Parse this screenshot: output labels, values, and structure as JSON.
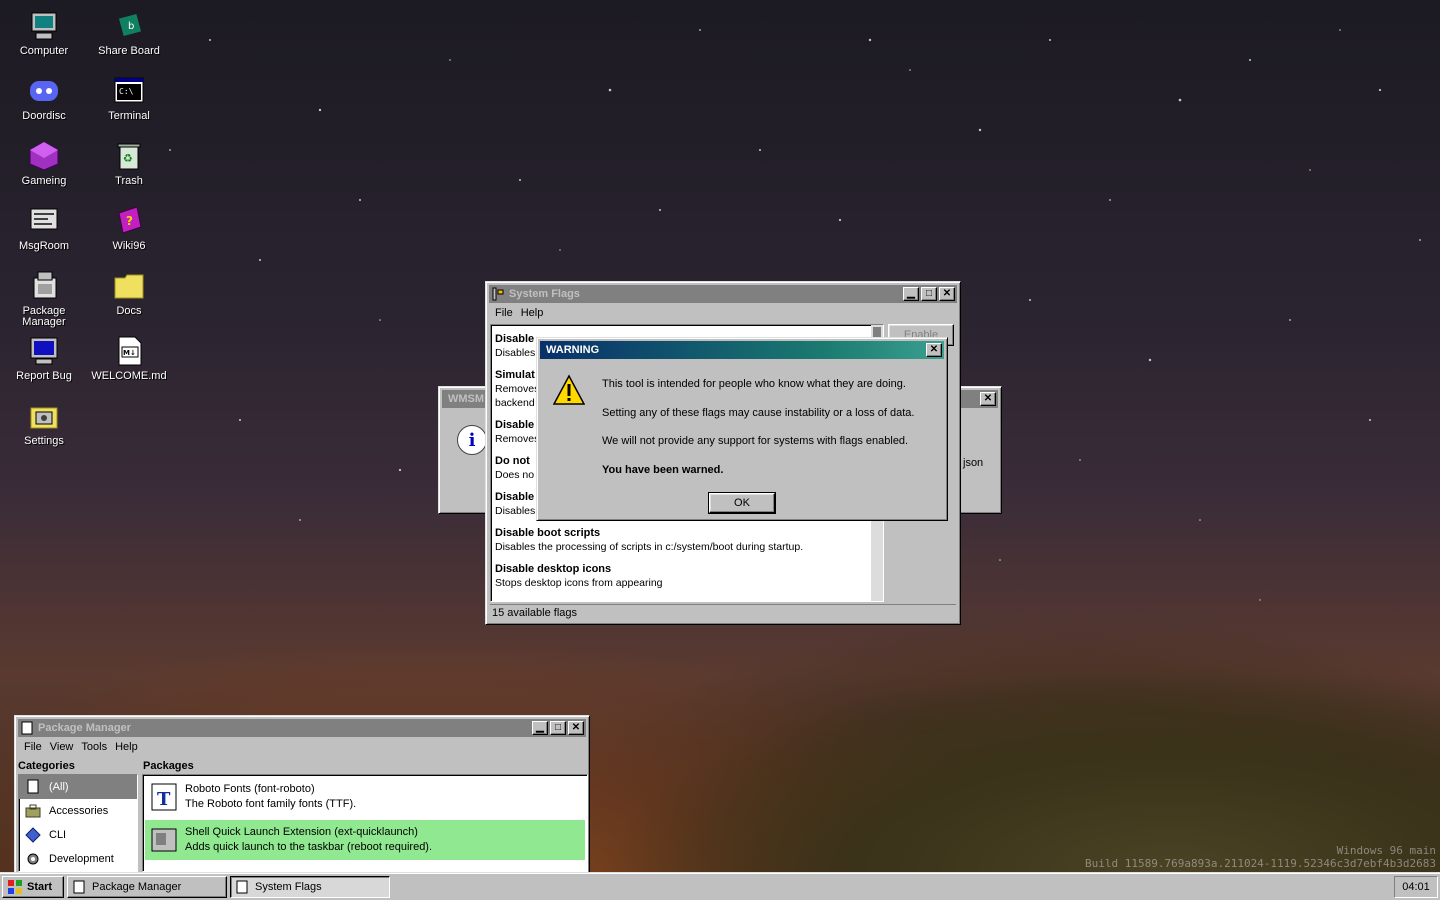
{
  "desktop_icons": [
    {
      "label": "Computer",
      "icon": "computer-icon"
    },
    {
      "label": "Share Board",
      "icon": "share-board-icon"
    },
    {
      "label": "Doordisc",
      "icon": "doordisc-icon"
    },
    {
      "label": "Terminal",
      "icon": "terminal-icon"
    },
    {
      "label": "Gameing",
      "icon": "gameing-icon"
    },
    {
      "label": "Trash",
      "icon": "trash-icon"
    },
    {
      "label": "MsgRoom",
      "icon": "msgroom-icon"
    },
    {
      "label": "Wiki96",
      "icon": "wiki96-icon"
    },
    {
      "label": "Package Manager",
      "icon": "package-manager-icon"
    },
    {
      "label": "Docs",
      "icon": "folder-icon"
    },
    {
      "label": "Report Bug",
      "icon": "report-bug-icon"
    },
    {
      "label": "WELCOME.md",
      "icon": "markdown-file-icon"
    },
    {
      "label": "Settings",
      "icon": "settings-icon"
    }
  ],
  "wmsm_window": {
    "title": "WMSM",
    "side_text": "json"
  },
  "system_flags": {
    "title": "System Flags",
    "menu": [
      "File",
      "Help"
    ],
    "right_button": "Enable",
    "flags": [
      {
        "title": "Disable",
        "desc": "Disables"
      },
      {
        "title": "Simulat",
        "desc": "Removes",
        "desc2": "backend"
      },
      {
        "title": "Disable",
        "desc": "Removes"
      },
      {
        "title": "Do not",
        "desc": "Does no"
      },
      {
        "title": "Disable",
        "desc": "Disables the system update notification."
      },
      {
        "title": "Disable boot scripts",
        "desc": "Disables the processing of scripts in c:/system/boot during startup."
      },
      {
        "title": "Disable desktop icons",
        "desc": "Stops desktop icons from appearing"
      }
    ],
    "status": "15 available flags"
  },
  "warning_dialog": {
    "title": "WARNING",
    "lines": [
      "This tool is intended for people who know what they are doing.",
      "Setting any of these flags may cause instability or a loss of data.",
      "We will not provide any support for systems with flags enabled."
    ],
    "emphasis": "You have been warned.",
    "ok_label": "OK"
  },
  "package_manager": {
    "title": "Package Manager",
    "menu": [
      "File",
      "View",
      "Tools",
      "Help"
    ],
    "categories_header": "Categories",
    "packages_header": "Packages",
    "categories": [
      "(All)",
      "Accessories",
      "CLI",
      "Development"
    ],
    "packages": [
      {
        "name": "Roboto Fonts (font-roboto)",
        "desc": "The Roboto font family fonts (TTF).",
        "selected": false
      },
      {
        "name": "Shell Quick Launch Extension (ext-quicklaunch)",
        "desc": "Adds quick launch to the taskbar (reboot required).",
        "selected": true
      }
    ]
  },
  "taskbar": {
    "start_label": "Start",
    "tasks": [
      {
        "label": "Package Manager",
        "pressed": false
      },
      {
        "label": "System Flags",
        "pressed": true
      }
    ],
    "clock": "04:01"
  },
  "watermark": {
    "line1": "Windows 96 main",
    "line2": "Build 11589.769a893a.211024-1119.52346c3d7ebf4b3d2683"
  },
  "colors": {
    "selection": "#90e890",
    "title_active": "#000080",
    "desktop_text": "#ffffff"
  }
}
